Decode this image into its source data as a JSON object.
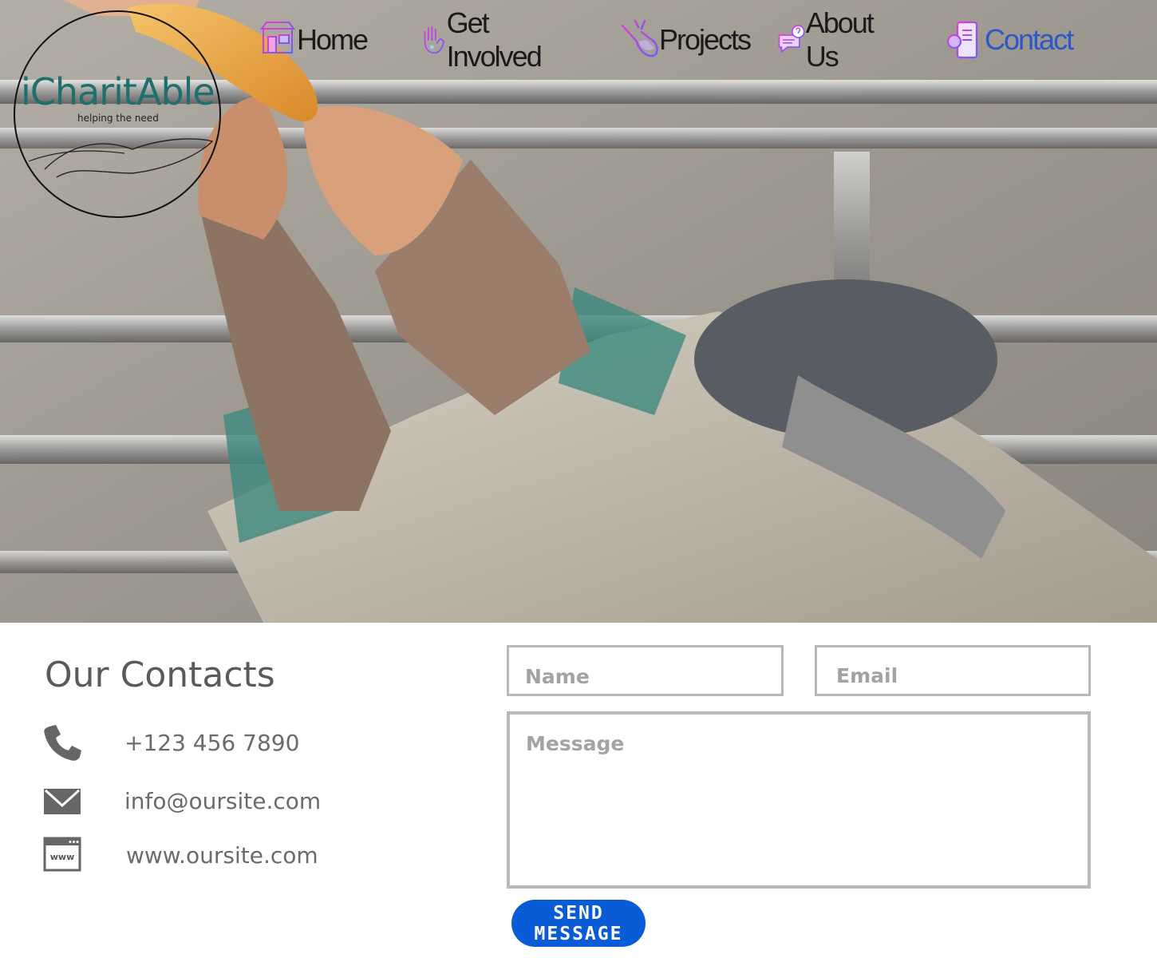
{
  "brand": {
    "name": "iCharitAble",
    "tagline": "helping the need"
  },
  "nav": {
    "items": [
      {
        "label": "Home",
        "icon": "home-store-icon",
        "active": false
      },
      {
        "label": "Get Involved",
        "icon": "raised-hand-icon",
        "active": false
      },
      {
        "label": "Projects",
        "icon": "hand-pointing-icon",
        "active": false
      },
      {
        "label": "About Us",
        "icon": "chat-question-icon",
        "active": false
      },
      {
        "label": "Contact",
        "icon": "contact-book-icon",
        "active": true
      }
    ]
  },
  "hero": {
    "image": "photo of a hand giving bread to a person in need"
  },
  "contacts": {
    "title": "Our Contacts",
    "phone": "+123 456 7890",
    "email": "info@oursite.com",
    "website": "www.oursite.com",
    "website_icon_text": "www"
  },
  "form": {
    "name_placeholder": "Name",
    "email_placeholder": "Email",
    "message_placeholder": "Message",
    "submit_label": "SEND MESSAGE"
  },
  "colors": {
    "accent": "#0a5bd6",
    "active_nav": "#2a57c9",
    "logo_text": "#1f6f6c",
    "nav_icon_gradient": [
      "#e63bd0",
      "#6a5cff"
    ]
  }
}
